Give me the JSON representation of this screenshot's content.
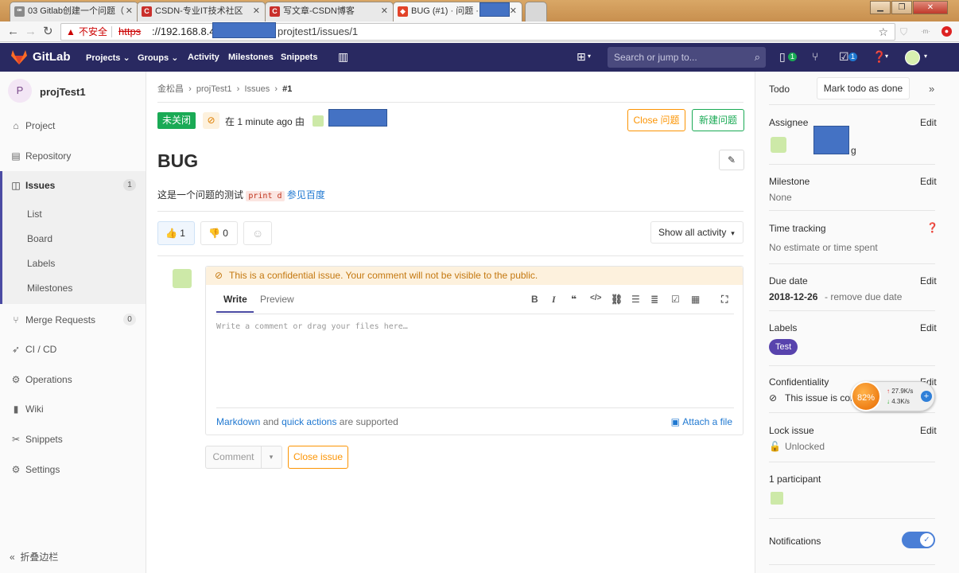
{
  "browser": {
    "tabs": [
      {
        "title": "03 Gitlab创建一个问题（"
      },
      {
        "title": "CSDN-专业IT技术社区"
      },
      {
        "title": "写文章-CSDN博客"
      },
      {
        "title": "BUG (#1) · 问题 · "
      }
    ],
    "url": {
      "insecure_label": "不安全",
      "scheme": "https",
      "host": "://192.168.8.40/",
      "path": "projtest1/issues/1"
    }
  },
  "header": {
    "brand": "GitLab",
    "nav": [
      "Projects",
      "Groups",
      "Activity",
      "Milestones",
      "Snippets"
    ],
    "search_placeholder": "Search or jump to...",
    "issues_count": "1",
    "todos_count": "1"
  },
  "sidebar": {
    "project_initial": "P",
    "project_name": "projTest1",
    "items": {
      "project": "Project",
      "repository": "Repository",
      "issues": "Issues",
      "issues_count": "1",
      "merge_requests": "Merge Requests",
      "merge_requests_count": "0",
      "cicd": "CI / CD",
      "operations": "Operations",
      "wiki": "Wiki",
      "snippets": "Snippets",
      "settings": "Settings"
    },
    "issues_sub": [
      "List",
      "Board",
      "Labels",
      "Milestones"
    ],
    "collapse": "折叠边栏"
  },
  "issue": {
    "breadcrumb": [
      "金松昌",
      "projTest1",
      "Issues",
      "#1"
    ],
    "status": "未关闭",
    "opened": "在 1 minute ago 由",
    "close_button": "Close 问题",
    "new_button": "新建问题",
    "title": "BUG",
    "description_text": "这是一个问题的测试",
    "description_code": "print d",
    "description_link": "参见百度",
    "thumbs_up": "1",
    "thumbs_down": "0",
    "activity_filter": "Show all activity"
  },
  "comment": {
    "confidential_warning": "This is a confidential issue. Your comment will not be visible to the public.",
    "tab_write": "Write",
    "tab_preview": "Preview",
    "placeholder": "Write a comment or drag your files here…",
    "markdown": "Markdown",
    "and": "and",
    "quick_actions": "quick actions",
    "supported": "are supported",
    "attach": "Attach a file",
    "comment_button": "Comment",
    "close_issue_button": "Close issue"
  },
  "right_sidebar": {
    "todo_label": "Todo",
    "todo_button": "Mark todo as done",
    "assignee_label": "Assignee",
    "assignee_suffix": "g",
    "edit": "Edit",
    "milestone_label": "Milestone",
    "milestone_value": "None",
    "time_tracking_label": "Time tracking",
    "time_tracking_value": "No estimate or time spent",
    "due_date_label": "Due date",
    "due_date_value": "2018-12-26",
    "remove_due_date": "- remove due date",
    "labels_label": "Labels",
    "label_value": "Test",
    "confidentiality_label": "Confidentiality",
    "confidentiality_value": "This issue is con",
    "lock_label": "Lock issue",
    "lock_value": "Unlocked",
    "participants": "1 participant",
    "notifications_label": "Notifications"
  },
  "net_widget": {
    "percent": "82%",
    "up": "27.9K/s",
    "down": "4.3K/s"
  },
  "colors": {
    "header_bg": "#292961",
    "status_open": "#1aaa55",
    "close_orange": "#fc9403",
    "link_blue": "#1f78d1",
    "label_purple": "#5843ad"
  }
}
